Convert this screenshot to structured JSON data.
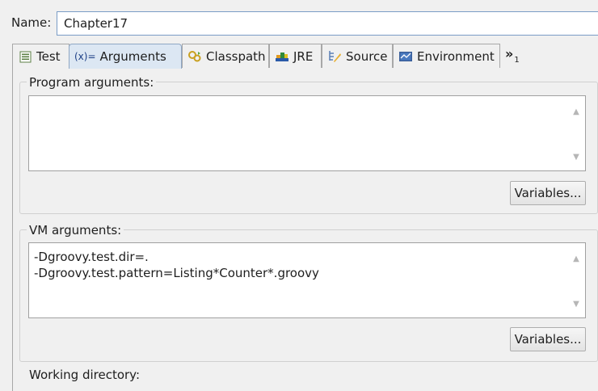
{
  "name_field": {
    "label": "Name:",
    "value": "Chapter17"
  },
  "tabs": [
    {
      "label": "Test",
      "icon": "test-icon",
      "active": false
    },
    {
      "label": "Arguments",
      "icon_text": "(x)=",
      "icon": "arguments-icon",
      "active": true
    },
    {
      "label": "Classpath",
      "icon": "classpath-icon",
      "active": false
    },
    {
      "label": "JRE",
      "icon": "jre-icon",
      "active": false
    },
    {
      "label": "Source",
      "icon": "source-icon",
      "active": false
    },
    {
      "label": "Environment",
      "icon": "environment-icon",
      "active": false
    }
  ],
  "overflow": {
    "symbol": "»",
    "count": "1"
  },
  "program_arguments": {
    "title": "Program arguments:",
    "value": "",
    "variables_label": "Variables..."
  },
  "vm_arguments": {
    "title": "VM arguments:",
    "value": "-Dgroovy.test.dir=.\n-Dgroovy.test.pattern=Listing*Counter*.groovy",
    "variables_label": "Variables..."
  },
  "working_directory": {
    "title": "Working directory:"
  },
  "colors": {
    "active_tab": "#dce7f3",
    "input_border": "#7a9cc6",
    "panel_bg": "#f0f0f0"
  }
}
